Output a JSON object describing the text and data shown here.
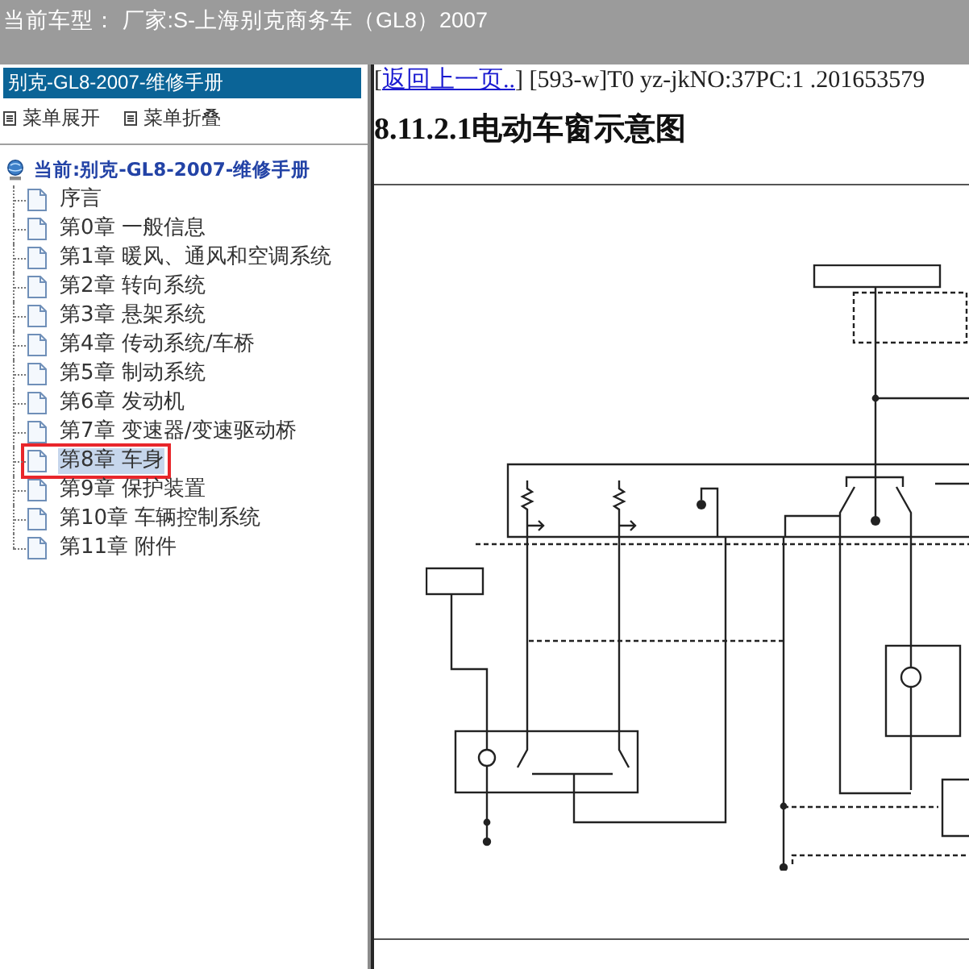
{
  "title_bar": {
    "text": "当前车型： 厂家:S-上海别克商务车（GL8）2007"
  },
  "sidebar": {
    "header": "别克-GL8-2007-维修手册",
    "menu_actions": [
      {
        "label": "菜单展开"
      },
      {
        "label": "菜单折叠"
      }
    ],
    "tree": {
      "label": "当前:别克-GL8-2007-维修手册",
      "children": [
        {
          "label": "序言",
          "selected": false,
          "marked": false
        },
        {
          "label": "第0章 一般信息",
          "selected": false,
          "marked": false
        },
        {
          "label": "第1章 暖风、通风和空调系统",
          "selected": false,
          "marked": false
        },
        {
          "label": "第2章 转向系统",
          "selected": false,
          "marked": false
        },
        {
          "label": "第3章 悬架系统",
          "selected": false,
          "marked": false
        },
        {
          "label": "第4章 传动系统/车桥",
          "selected": false,
          "marked": false
        },
        {
          "label": "第5章 制动系统",
          "selected": false,
          "marked": false
        },
        {
          "label": "第6章 发动机",
          "selected": false,
          "marked": false
        },
        {
          "label": "第7章 变速器/变速驱动桥",
          "selected": false,
          "marked": false
        },
        {
          "label": "第8章 车身",
          "selected": true,
          "marked": true
        },
        {
          "label": "第9章 保护装置",
          "selected": false,
          "marked": false
        },
        {
          "label": "第10章 车辆控制系统",
          "selected": false,
          "marked": false
        },
        {
          "label": "第11章 附件",
          "selected": false,
          "marked": false
        }
      ]
    }
  },
  "content": {
    "reference_line": {
      "before": "[",
      "link": "返回上一页..",
      "after": "] [593-w]T0 yz-jkNO:37PC:1 .201653579"
    },
    "heading": "8.11.2.1电动车窗示意图"
  }
}
